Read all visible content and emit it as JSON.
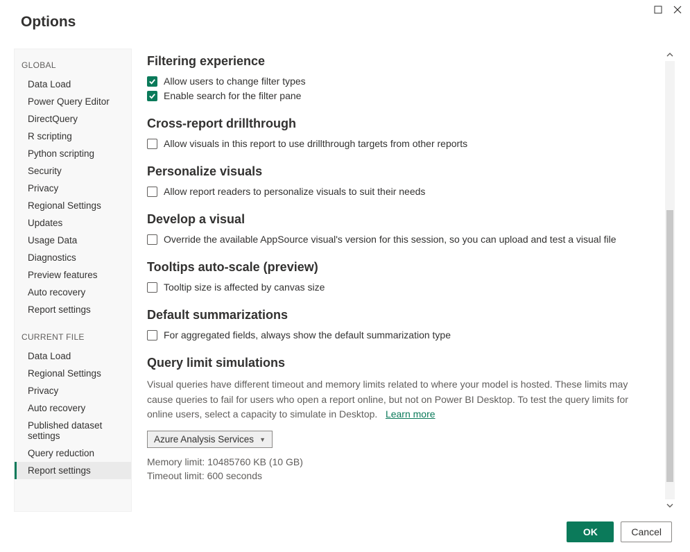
{
  "window": {
    "title": "Options"
  },
  "sidebar": {
    "global_header": "GLOBAL",
    "global_items": [
      "Data Load",
      "Power Query Editor",
      "DirectQuery",
      "R scripting",
      "Python scripting",
      "Security",
      "Privacy",
      "Regional Settings",
      "Updates",
      "Usage Data",
      "Diagnostics",
      "Preview features",
      "Auto recovery",
      "Report settings"
    ],
    "current_header": "CURRENT FILE",
    "current_items": [
      "Data Load",
      "Regional Settings",
      "Privacy",
      "Auto recovery",
      "Published dataset settings",
      "Query reduction",
      "Report settings"
    ],
    "selected": "Report settings"
  },
  "sections": {
    "filtering": {
      "heading": "Filtering experience",
      "opt1": "Allow users to change filter types",
      "opt2": "Enable search for the filter pane"
    },
    "crossreport": {
      "heading": "Cross-report drillthrough",
      "opt1": "Allow visuals in this report to use drillthrough targets from other reports"
    },
    "personalize": {
      "heading": "Personalize visuals",
      "opt1": "Allow report readers to personalize visuals to suit their needs"
    },
    "develop": {
      "heading": "Develop a visual",
      "opt1": "Override the available AppSource visual's version for this session, so you can upload and test a visual file"
    },
    "tooltips": {
      "heading": "Tooltips auto-scale (preview)",
      "opt1": "Tooltip size is affected by canvas size"
    },
    "defaultsum": {
      "heading": "Default summarizations",
      "opt1": "For aggregated fields, always show the default summarization type"
    },
    "querylimit": {
      "heading": "Query limit simulations",
      "desc": "Visual queries have different timeout and memory limits related to where your model is hosted. These limits may cause queries to fail for users who open a report online, but not on Power BI Desktop. To test the query limits for online users, select a capacity to simulate in Desktop.",
      "learn_more": "Learn more",
      "dropdown": "Azure Analysis Services",
      "memory": "Memory limit: 10485760 KB (10 GB)",
      "timeout": "Timeout limit: 600 seconds"
    }
  },
  "footer": {
    "ok": "OK",
    "cancel": "Cancel"
  }
}
